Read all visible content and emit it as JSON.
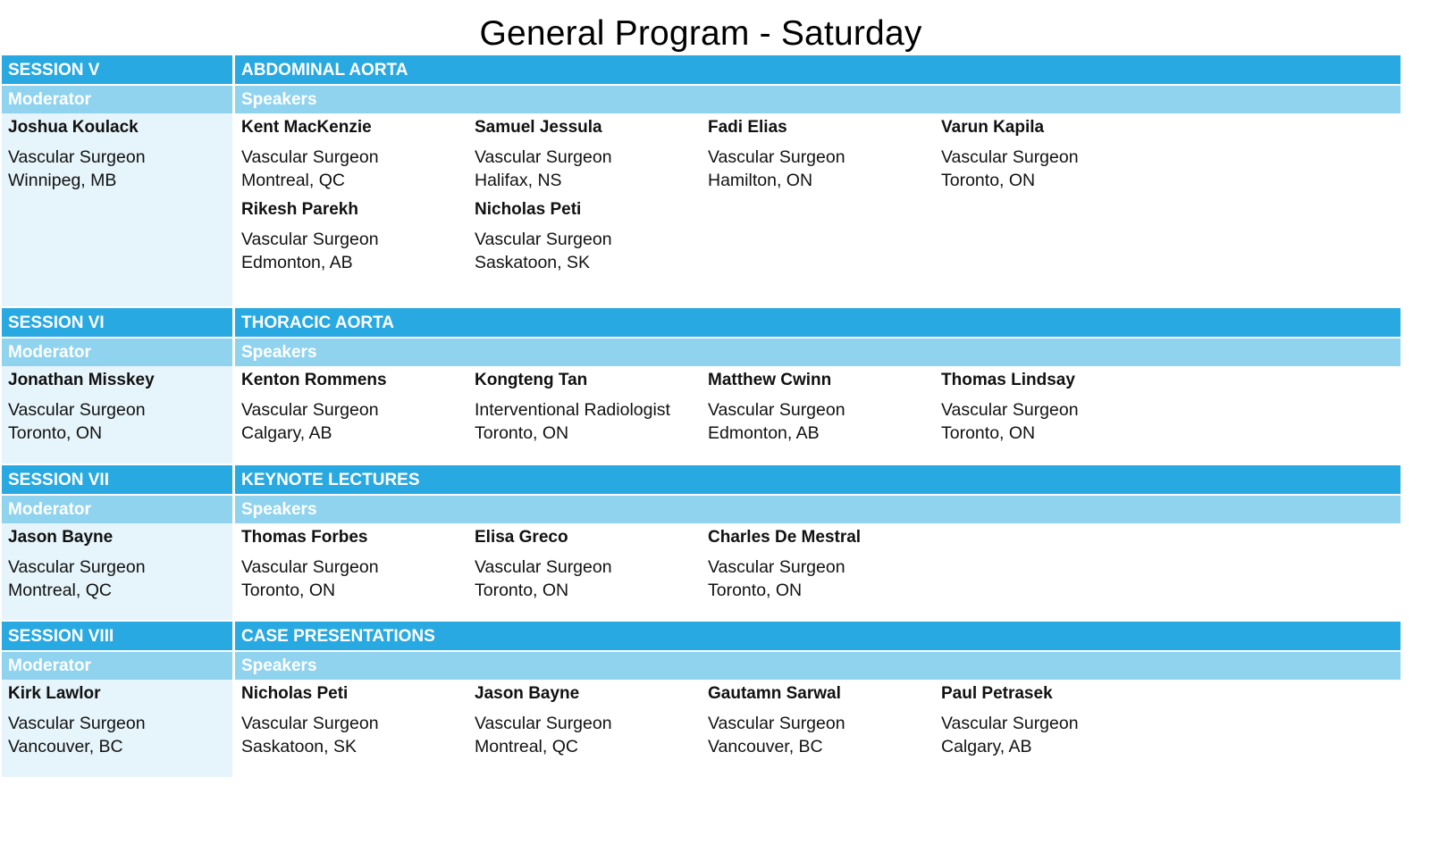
{
  "title": "General Program - Saturday",
  "sessions": [
    {
      "session_label": "SESSION V",
      "topic": "ABDOMINAL AORTA",
      "moderator_header": "Moderator",
      "speakers_header": "Speakers",
      "moderator": {
        "name": "Joshua Koulack",
        "role": "Vascular Surgeon",
        "location": "Winnipeg, MB"
      },
      "speakers": [
        {
          "name": "Kent MacKenzie",
          "role": "Vascular Surgeon",
          "location": "Montreal, QC"
        },
        {
          "name": "Samuel Jessula",
          "role": "Vascular Surgeon",
          "location": "Halifax, NS"
        },
        {
          "name": "Fadi Elias",
          "role": "Vascular Surgeon",
          "location": "Hamilton, ON"
        },
        {
          "name": "Varun Kapila",
          "role": "Vascular Surgeon",
          "location": "Toronto, ON"
        },
        {
          "name": "Rikesh Parekh",
          "role": "Vascular Surgeon",
          "location": "Edmonton, AB"
        },
        {
          "name": "Nicholas Peti",
          "role": "Vascular Surgeon",
          "location": "Saskatoon, SK"
        }
      ]
    },
    {
      "session_label": "SESSION VI",
      "topic": "THORACIC AORTA",
      "moderator_header": "Moderator",
      "speakers_header": "Speakers",
      "moderator": {
        "name": "Jonathan Misskey",
        "role": "Vascular Surgeon",
        "location": "Toronto, ON"
      },
      "speakers": [
        {
          "name": "Kenton Rommens",
          "role": "Vascular Surgeon",
          "location": "Calgary, AB"
        },
        {
          "name": "Kongteng Tan",
          "role": "Interventional Radiologist",
          "location": "Toronto, ON"
        },
        {
          "name": "Matthew Cwinn",
          "role": "Vascular Surgeon",
          "location": "Edmonton, AB"
        },
        {
          "name": "Thomas Lindsay",
          "role": "Vascular Surgeon",
          "location": "Toronto, ON"
        }
      ]
    },
    {
      "session_label": "SESSION VII",
      "topic": "KEYNOTE LECTURES",
      "moderator_header": "Moderator",
      "speakers_header": "Speakers",
      "moderator": {
        "name": "Jason Bayne",
        "role": "Vascular Surgeon",
        "location": "Montreal, QC"
      },
      "speakers": [
        {
          "name": "Thomas Forbes",
          "role": "Vascular Surgeon",
          "location": "Toronto, ON"
        },
        {
          "name": "Elisa Greco",
          "role": "Vascular Surgeon",
          "location": "Toronto, ON"
        },
        {
          "name": "Charles De Mestral",
          "role": "Vascular Surgeon",
          "location": "Toronto, ON"
        }
      ]
    },
    {
      "session_label": "SESSION VIII",
      "topic": "CASE PRESENTATIONS",
      "moderator_header": "Moderator",
      "speakers_header": "Speakers",
      "moderator": {
        "name": "Kirk Lawlor",
        "role": "Vascular Surgeon",
        "location": "Vancouver, BC"
      },
      "speakers": [
        {
          "name": "Nicholas Peti",
          "role": "Vascular Surgeon",
          "location": "Saskatoon, SK"
        },
        {
          "name": "Jason Bayne",
          "role": "Vascular Surgeon",
          "location": "Montreal, QC"
        },
        {
          "name": "Gautamn Sarwal",
          "role": "Vascular Surgeon",
          "location": "Vancouver, BC"
        },
        {
          "name": "Paul Petrasek",
          "role": "Vascular Surgeon",
          "location": "Calgary, AB"
        }
      ]
    }
  ]
}
